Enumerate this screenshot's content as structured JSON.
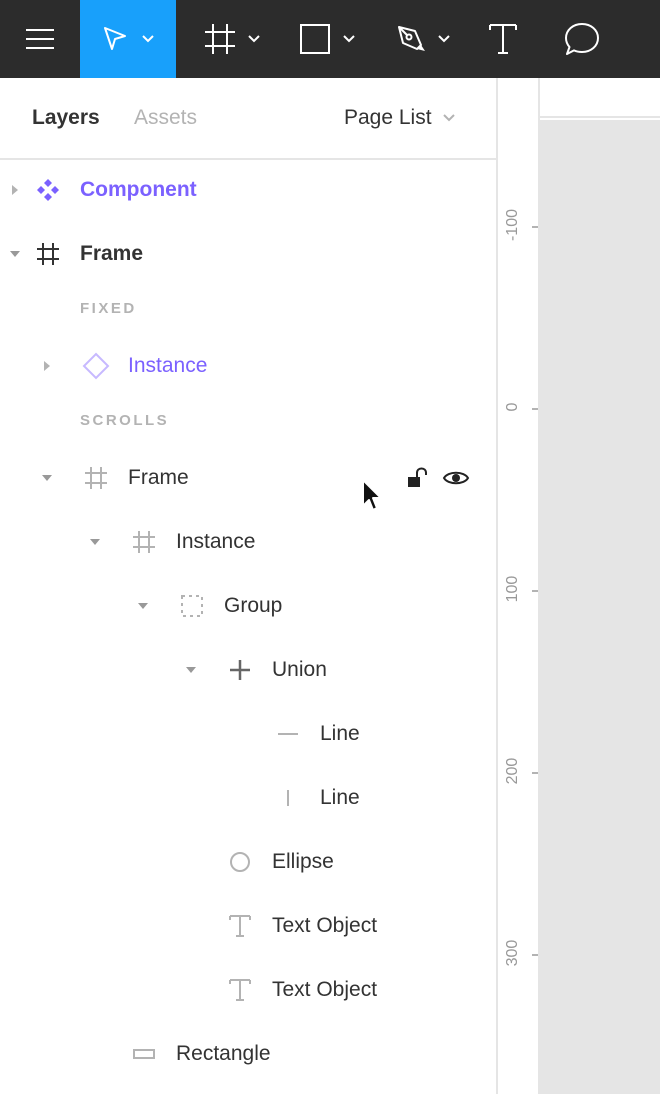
{
  "toolbar": {
    "tools": [
      {
        "name": "menu",
        "icon": "hamburger-menu-icon",
        "active": false
      },
      {
        "name": "move",
        "icon": "move-pointer-icon",
        "active": true,
        "has_dropdown": true
      },
      {
        "name": "frame",
        "icon": "frame-hash-icon",
        "active": false,
        "has_dropdown": true
      },
      {
        "name": "shape",
        "icon": "rectangle-icon",
        "active": false,
        "has_dropdown": true
      },
      {
        "name": "pen",
        "icon": "pen-icon",
        "active": false,
        "has_dropdown": true
      },
      {
        "name": "text",
        "icon": "text-icon",
        "active": false
      },
      {
        "name": "comment",
        "icon": "comment-bubble-icon",
        "active": false
      }
    ],
    "active_color": "#18a0fb",
    "background": "#2c2c2c"
  },
  "panel": {
    "tabs": [
      {
        "label": "Layers",
        "active": true
      },
      {
        "label": "Assets",
        "active": false
      }
    ],
    "page_list_label": "Page List",
    "section_fixed": "FIXED",
    "section_scrolls": "SCROLLS",
    "layers": [
      {
        "label": "Component",
        "icon": "component-icon",
        "chevron": "collapsed",
        "style": "component"
      },
      {
        "label": "Frame",
        "icon": "frame-hash-icon",
        "chevron": "expanded",
        "style": "bold"
      },
      {
        "label": "Instance",
        "icon": "instance-diamond-icon",
        "chevron": "collapsed",
        "style": "component"
      },
      {
        "label": "Frame",
        "icon": "frame-hash-icon",
        "chevron": "expanded",
        "style": "normal",
        "hovered": true
      },
      {
        "label": "Instance",
        "icon": "frame-hash-icon",
        "chevron": "expanded",
        "style": "normal"
      },
      {
        "label": "Group",
        "icon": "group-dashed-icon",
        "chevron": "expanded",
        "style": "normal"
      },
      {
        "label": "Union",
        "icon": "union-plus-icon",
        "chevron": "expanded",
        "style": "normal"
      },
      {
        "label": "Line",
        "icon": "horizontal-line-icon",
        "chevron": "none",
        "style": "normal"
      },
      {
        "label": "Line",
        "icon": "vertical-line-icon",
        "chevron": "none",
        "style": "normal"
      },
      {
        "label": "Ellipse",
        "icon": "ellipse-icon",
        "chevron": "none",
        "style": "normal"
      },
      {
        "label": "Text Object",
        "icon": "text-icon",
        "chevron": "none",
        "style": "normal"
      },
      {
        "label": "Text Object",
        "icon": "text-icon",
        "chevron": "none",
        "style": "normal"
      },
      {
        "label": "Rectangle",
        "icon": "rectangle-icon",
        "chevron": "none",
        "style": "normal"
      }
    ],
    "component_color": "#7b61ff"
  },
  "ruler": {
    "labels": [
      "-100",
      "0",
      "100",
      "200",
      "300"
    ]
  }
}
